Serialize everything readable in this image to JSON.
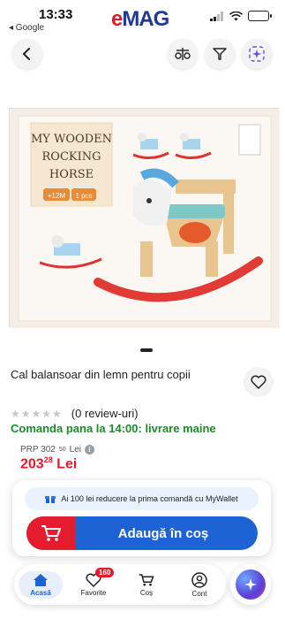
{
  "status_bar": {
    "time": "13:33",
    "back_app": "◂ Google",
    "logo_e": "e",
    "logo_rest": "MAG"
  },
  "product": {
    "title": "Cal balansoar din lemn pentru copii",
    "box_text_line1": "MY WOODEN",
    "box_text_line2": "ROCKING",
    "box_text_line3": "HORSE",
    "box_age": "+12M",
    "box_pcs": "1 pcs",
    "rating_count": "(0 review-uri)",
    "delivery": "Comanda pana la 14:00: livrare maine",
    "prp_label": "PRP 302",
    "prp_cents": "50",
    "prp_currency": "Lei",
    "price_whole": "203",
    "price_cents": "28",
    "price_currency": "Lei"
  },
  "cart_card": {
    "wallet_text": "Ai 100 lei reducere la prima comandă cu MyWallet",
    "add_label": "Adaugă în coș"
  },
  "tabbar": {
    "items": [
      {
        "label": "Acasă"
      },
      {
        "label": "Favorite",
        "badge": "160"
      },
      {
        "label": "Coș"
      },
      {
        "label": "Cont"
      }
    ]
  },
  "colors": {
    "brand_red": "#e11b2a",
    "brand_blue": "#1d63d6",
    "delivery_green": "#1a8a2a"
  }
}
